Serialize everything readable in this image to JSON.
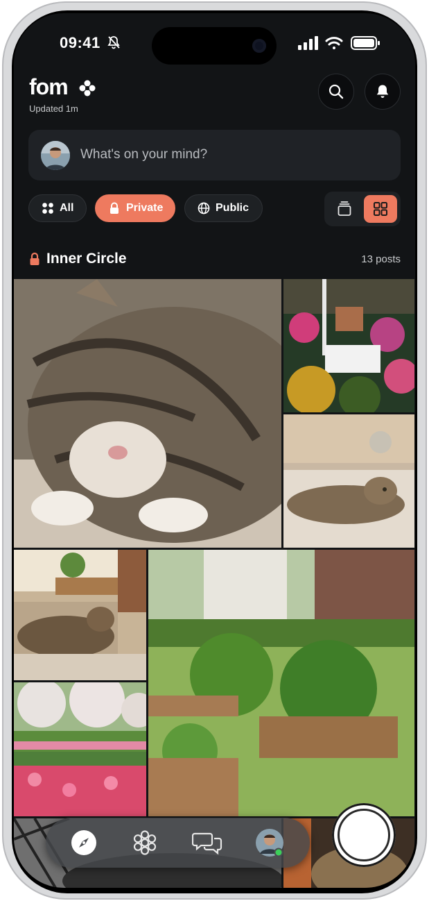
{
  "status": {
    "time": "09:41",
    "icons": [
      "bell-slash-icon",
      "cellular-icon",
      "wifi-icon",
      "battery-icon"
    ]
  },
  "header": {
    "logo": "fom",
    "updated": "Updated 1m",
    "icons": [
      "search-icon",
      "bell-icon"
    ]
  },
  "composer": {
    "placeholder": "What's on your mind?"
  },
  "filters": {
    "all_label": "All",
    "private_label": "Private",
    "public_label": "Public",
    "selected": "Private"
  },
  "view_toggle": {
    "options": [
      "stack-view-icon",
      "grid-view-icon"
    ],
    "selected": "grid-view-icon"
  },
  "section": {
    "title": "Inner Circle",
    "count": "13 posts"
  },
  "posts": [
    {
      "subject": "sleeping tabby cat"
    },
    {
      "subject": "cottage flower garden with picket fence"
    },
    {
      "subject": "tabby cat lying on sofa"
    },
    {
      "subject": "cat on armchair by window"
    },
    {
      "subject": "raised garden beds with vegetables"
    },
    {
      "subject": "tulip field with blossom trees"
    },
    {
      "subject": "black and white photo"
    },
    {
      "subject": "cat photo"
    }
  ],
  "tabbar": {
    "items": [
      "compass-icon",
      "flower-icon",
      "chat-bubbles-icon",
      "profile-avatar"
    ],
    "selected": "compass-icon"
  },
  "colors": {
    "accent": "#ee7a5f",
    "background": "#121416",
    "surface": "#1f2226",
    "online": "#3ccf5a"
  }
}
